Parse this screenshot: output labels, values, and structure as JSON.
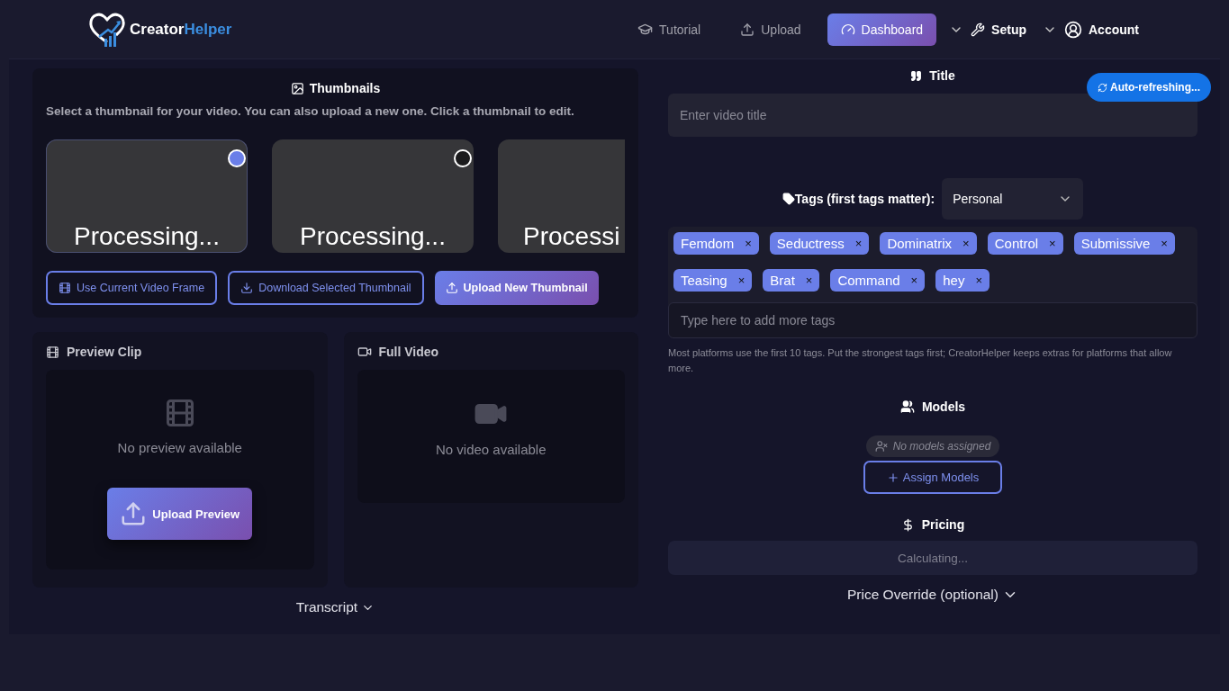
{
  "brand": {
    "name_first": "Creator",
    "name_second": "Helper"
  },
  "nav": [
    {
      "label": "Tutorial",
      "selected": false,
      "dropdown": false
    },
    {
      "label": "Upload",
      "selected": false,
      "dropdown": false
    },
    {
      "label": "Dashboard",
      "selected": true,
      "dropdown": false
    },
    {
      "label": "Setup",
      "selected": false,
      "dropdown": true
    },
    {
      "label": "Account",
      "selected": false,
      "dropdown": true
    }
  ],
  "badge": {
    "label": "Auto-refreshing..."
  },
  "thumbnails": {
    "title": "Thumbnails",
    "hint": "Select a thumbnail for your video. You can also upload a new one. Click a thumbnail to edit.",
    "items": [
      {
        "label": "Processing...",
        "selected": true
      },
      {
        "label": "Processing...",
        "selected": false
      },
      {
        "label": "Processi",
        "selected": false
      }
    ],
    "buttons": [
      {
        "label": "Use Current Video Frame",
        "kind": "outline"
      },
      {
        "label": "Download Selected Thumbnail",
        "kind": "outline"
      },
      {
        "label": "Upload New Thumbnail",
        "kind": "primary"
      }
    ]
  },
  "preview_clip": {
    "title": "Preview Clip",
    "empty": "No preview available",
    "button": "Upload Preview"
  },
  "full_video": {
    "title": "Full Video",
    "empty": "No video available"
  },
  "transcript": {
    "label": "Transcript"
  },
  "title_field": {
    "label": "Title",
    "placeholder": "Enter video title"
  },
  "tags": {
    "label": "Tags (first tags matter):",
    "category": "Personal",
    "items": [
      "Femdom",
      "Seductress",
      "Dominatrix",
      "Control",
      "Submissive",
      "Teasing",
      "Brat",
      "Command",
      "hey"
    ],
    "remove": "×",
    "placeholder": "Type here to add more tags",
    "note": "Most platforms use the first 10 tags. Put the strongest tags first; CreatorHelper keeps extras for platforms that allow more."
  },
  "models": {
    "title": "Models",
    "empty": "No models assigned",
    "button": "Assign Models"
  },
  "pricing": {
    "title": "Pricing",
    "status": "Calculating...",
    "override": "Price Override (optional)"
  }
}
